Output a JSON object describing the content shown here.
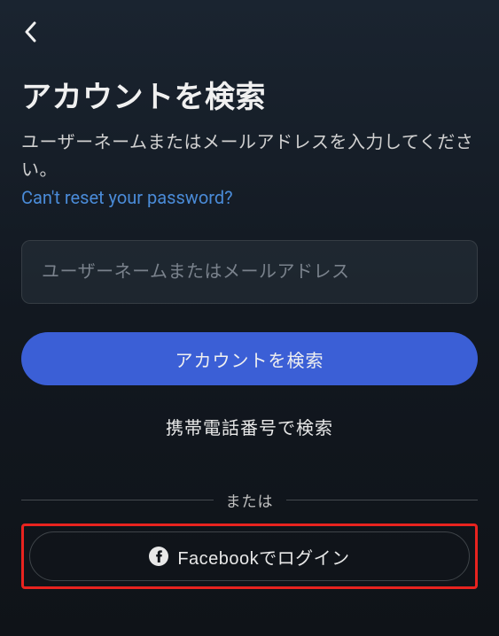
{
  "header": {
    "title": "アカウントを検索",
    "subtitle": "ユーザーネームまたはメールアドレスを入力してください。",
    "help_link": "Can't reset your password?"
  },
  "form": {
    "input_placeholder": "ユーザーネームまたはメールアドレス",
    "search_button": "アカウントを検索",
    "phone_search_link": "携帯電話番号で検索"
  },
  "divider": {
    "label": "または"
  },
  "facebook": {
    "button_label": "Facebookでログイン"
  }
}
